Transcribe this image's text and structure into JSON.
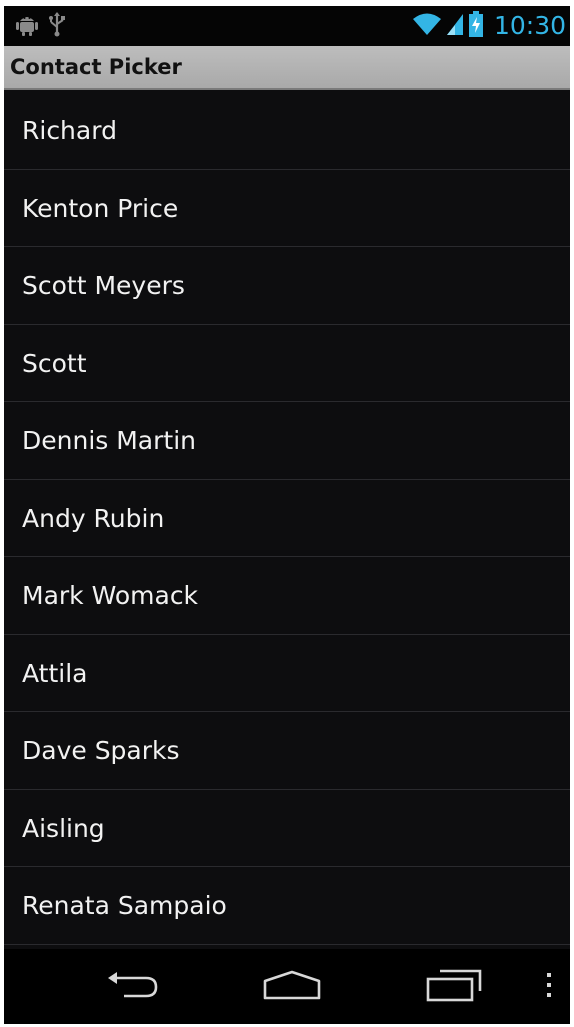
{
  "status_bar": {
    "time": "10:30",
    "icons": [
      "android-debug-icon",
      "usb-icon",
      "wifi-icon",
      "signal-icon",
      "battery-charging-icon"
    ],
    "accent_color": "#33b5e5"
  },
  "title_bar": {
    "title": "Contact Picker"
  },
  "contacts": [
    {
      "name": "Richard"
    },
    {
      "name": "Kenton Price"
    },
    {
      "name": "Scott Meyers"
    },
    {
      "name": "Scott"
    },
    {
      "name": "Dennis Martin"
    },
    {
      "name": "Andy Rubin"
    },
    {
      "name": "Mark Womack"
    },
    {
      "name": "Attila"
    },
    {
      "name": "Dave Sparks"
    },
    {
      "name": "Aisling"
    },
    {
      "name": "Renata Sampaio"
    }
  ],
  "nav_bar": {
    "buttons": [
      "back-icon",
      "home-icon",
      "recent-apps-icon",
      "overflow-menu-icon"
    ]
  },
  "colors": {
    "background": "#0d0d0f",
    "title_bar": "#b3b3b3",
    "divider": "#2a2a2e",
    "text": "#f2f2f2"
  }
}
